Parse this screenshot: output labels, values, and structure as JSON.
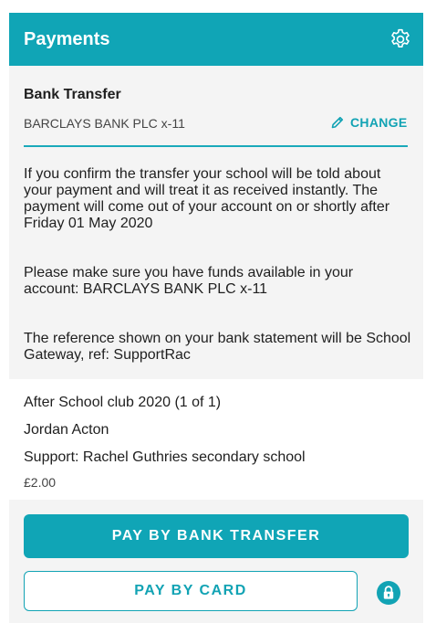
{
  "header": {
    "title": "Payments",
    "settings_icon": "gear-icon",
    "color": "#10a5b6"
  },
  "bank_transfer": {
    "title": "Bank Transfer",
    "account": "BARCLAYS BANK PLC x-11",
    "change_label": "CHANGE",
    "change_icon": "pencil-icon",
    "paragraphs": [
      "If you confirm the transfer your school will be told about your payment and will treat it as received instantly. The payment will come out of your account on or shortly after Friday 01 May 2020",
      "Please make sure you have funds available in your account: BARCLAYS BANK PLC x-11",
      "The reference shown on your bank statement will be School Gateway, ref: SupportRac"
    ]
  },
  "order": {
    "item": "After School club 2020 (1 of 1)",
    "student": "Jordan Acton",
    "school": "Support: Rachel Guthries secondary school",
    "price": "£2.00"
  },
  "actions": {
    "pay_bank_label": "PAY BY BANK TRANSFER",
    "pay_card_label": "PAY BY CARD",
    "lock_icon": "lock-icon",
    "accent": "#12a3b4"
  }
}
